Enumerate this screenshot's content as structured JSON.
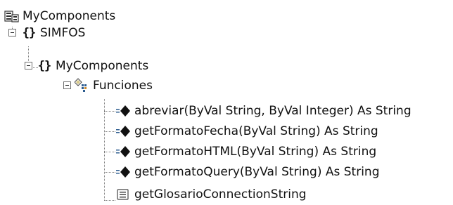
{
  "tree": {
    "root": {
      "label": "MyComponents",
      "icon": "assembly-icon"
    },
    "namespace_1": {
      "label": "SIMFOS",
      "icon": "namespace-icon",
      "glyph": "{}"
    },
    "namespace_2": {
      "label": "MyComponents",
      "icon": "namespace-icon",
      "glyph": "{}"
    },
    "module": {
      "label": "Funciones",
      "icon": "module-icon"
    },
    "members": [
      {
        "label": "abreviar(ByVal String, ByVal Integer) As String",
        "icon": "method-icon"
      },
      {
        "label": "getFormatoFecha(ByVal String) As String",
        "icon": "method-icon"
      },
      {
        "label": "getFormatoHTML(ByVal String) As String",
        "icon": "method-icon"
      },
      {
        "label": "getFormatoQuery(ByVal String) As String",
        "icon": "method-icon"
      },
      {
        "label": "getGlosarioConnectionString",
        "icon": "property-icon"
      }
    ]
  },
  "colors": {
    "method": "#111111",
    "method_accent": "#2d5c8f",
    "tree_lines": "#7c7c7c"
  }
}
